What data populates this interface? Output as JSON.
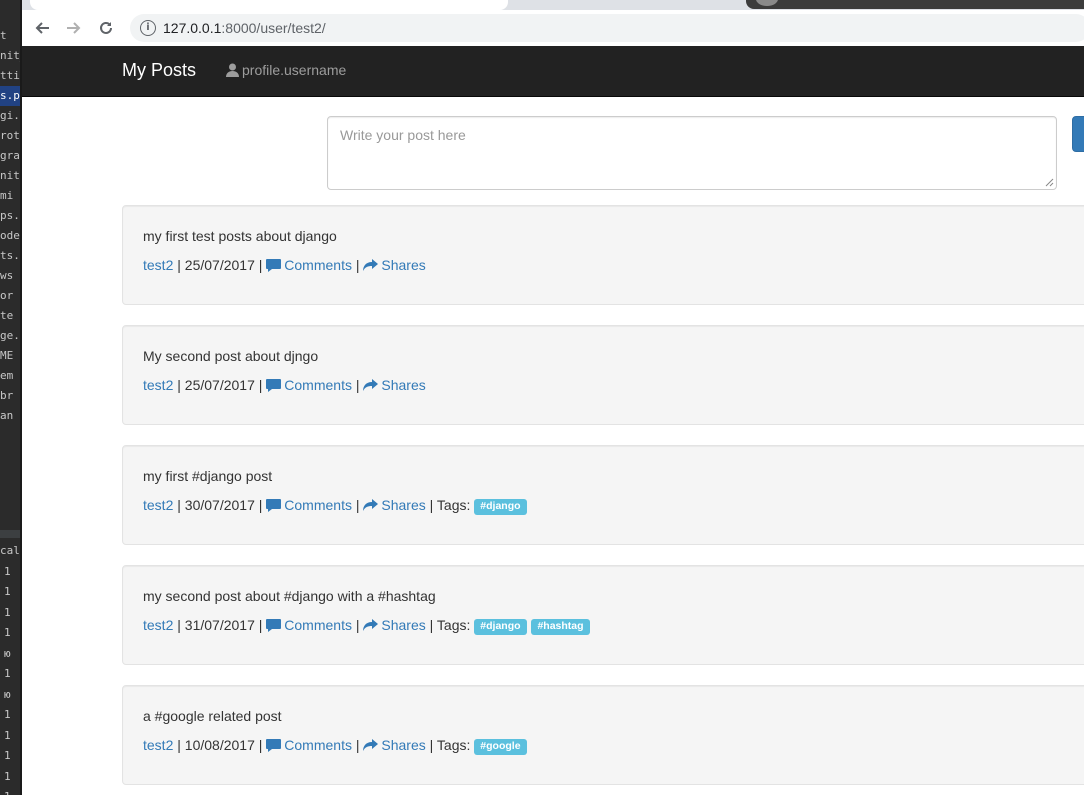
{
  "ide": {
    "lines": [
      "t",
      "nit_",
      "ttin",
      "s.p",
      "gi.",
      "rot",
      "gra",
      "nit",
      "mi",
      "ps.",
      "ode",
      "ts.",
      "ws",
      "or",
      "te",
      "ge.",
      "ME",
      "em",
      "br",
      "an"
    ],
    "lower_lines": [
      "cal",
      "1",
      "1",
      "1",
      "1",
      "ю",
      "1",
      "ю",
      "1",
      "1",
      "1",
      "1",
      "1"
    ]
  },
  "browser": {
    "back_icon": "arrow-left-icon",
    "forward_icon": "arrow-right-icon",
    "reload_icon": "reload-icon",
    "info_icon": "info-icon",
    "url_host": "127.0.0.1",
    "url_rest": ":8000/user/test2/"
  },
  "navbar": {
    "brand": "My Posts",
    "user_icon": "user-icon",
    "user_label": "profile.username"
  },
  "form": {
    "placeholder": "Write your post here"
  },
  "posts": [
    {
      "text": "my first test posts about django",
      "author": "test2",
      "date": "25/07/2017",
      "comments": "Comments",
      "shares": "Shares",
      "tags": []
    },
    {
      "text": "My second post about djngo",
      "author": "test2",
      "date": "25/07/2017",
      "comments": "Comments",
      "shares": "Shares",
      "tags": []
    },
    {
      "text": "my first #django post",
      "author": "test2",
      "date": "30/07/2017",
      "comments": "Comments",
      "shares": "Shares",
      "tags_label": "Tags:",
      "tags": [
        "#django"
      ]
    },
    {
      "text": "my second post about #django with a #hashtag",
      "author": "test2",
      "date": "31/07/2017",
      "comments": "Comments",
      "shares": "Shares",
      "tags_label": "Tags:",
      "tags": [
        "#django",
        "#hashtag"
      ]
    },
    {
      "text": "a #google related post",
      "author": "test2",
      "date": "10/08/2017",
      "comments": "Comments",
      "shares": "Shares",
      "tags_label": "Tags:",
      "tags": [
        "#google"
      ]
    }
  ],
  "separators": {
    "pipe": "|"
  },
  "colors": {
    "navbar_bg": "#222222",
    "link": "#337ab7",
    "tag_bg": "#5bc0de",
    "post_bg": "#f5f5f5"
  }
}
